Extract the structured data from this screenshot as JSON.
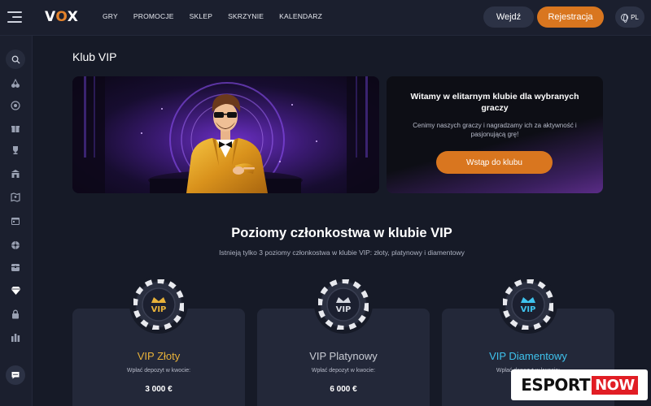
{
  "brand": {
    "logo_v": "V",
    "logo_o": "O",
    "logo_x": "X"
  },
  "nav": {
    "items": [
      "GRY",
      "PROMOCJE",
      "SKLEP",
      "SKRZYNIE",
      "KALENDARZ"
    ]
  },
  "header": {
    "login_label": "Wejdź",
    "register_label": "Rejestracja",
    "lang_label": "PL"
  },
  "sidebar": {
    "icons": [
      "search-icon",
      "cherries-icon",
      "target-icon",
      "gift-icon",
      "trophy-icon",
      "shop-icon",
      "map-icon",
      "calendar-icon",
      "wheel-icon",
      "chest-icon",
      "diamond-icon",
      "lock-icon",
      "stats-icon",
      "chat-icon"
    ],
    "active": "diamond-icon"
  },
  "page": {
    "title": "Klub VIP"
  },
  "promo": {
    "title": "Witamy w elitarnym klubie dla wybranych graczy",
    "subtitle": "Cenimy naszych graczy i nagradzamy ich za aktywność i pasjonującą grę!",
    "cta": "Wstąp do klubu"
  },
  "levels": {
    "title": "Poziomy członkostwa w klubie VIP",
    "subtitle": "Istnieją tylko 3 poziomy członkostwa w klubie VIP: złoty, platynowy i diamentowy",
    "chip_text": "VIP",
    "tiers": [
      {
        "name": "VIP Złoty",
        "label": "Wpłać depozyt w kwocie:",
        "amount": "3 000 €",
        "color": "#e8b23a"
      },
      {
        "name": "VIP Platynowy",
        "label": "Wpłać depozyt w kwocie:",
        "amount": "6 000 €",
        "color": "#c9ccd4"
      },
      {
        "name": "VIP Diamentowy",
        "label": "Wpłać depozyt w kwocie:",
        "amount": "",
        "color": "#3fc3ee"
      }
    ]
  },
  "watermark": {
    "left": "ESPORT",
    "right": "NOW"
  },
  "colors": {
    "accent": "#d9761f",
    "background": "#161a27",
    "panel": "#232839"
  }
}
